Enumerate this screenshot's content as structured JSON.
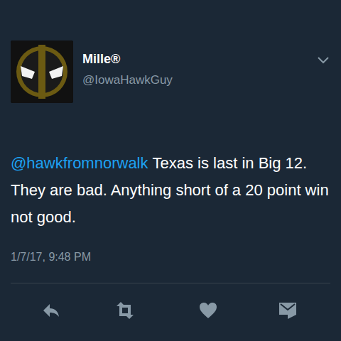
{
  "tweet": {
    "user": {
      "name": "Mille®",
      "handle": "@IowaHawkGuy"
    },
    "mention": "@hawkfromnorwalk",
    "text": "Texas is last in Big 12. They are bad. Anything short of a 20 point win not good.",
    "timestamp": "1/7/17, 9:48 PM"
  }
}
